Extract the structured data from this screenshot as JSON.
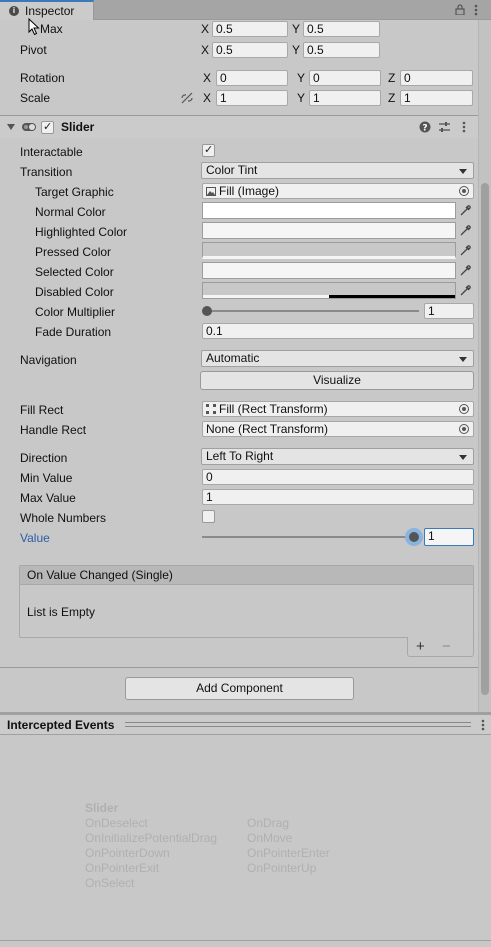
{
  "window": {
    "tab_label": "Inspector"
  },
  "rect_transform": {
    "max": {
      "label": "Max",
      "x": "0.5",
      "y": "0.5"
    },
    "pivot": {
      "label": "Pivot",
      "x": "0.5",
      "y": "0.5"
    },
    "rotation": {
      "label": "Rotation",
      "x": "0",
      "y": "0",
      "z": "0"
    },
    "scale": {
      "label": "Scale",
      "x": "1",
      "y": "1",
      "z": "1"
    }
  },
  "slider": {
    "title": "Slider",
    "interactable_label": "Interactable",
    "transition_label": "Transition",
    "transition_value": "Color Tint",
    "target_graphic_label": "Target Graphic",
    "target_graphic_value": "Fill (Image)",
    "normal_color_label": "Normal Color",
    "highlighted_color_label": "Highlighted Color",
    "pressed_color_label": "Pressed Color",
    "selected_color_label": "Selected Color",
    "disabled_color_label": "Disabled Color",
    "color_multiplier_label": "Color Multiplier",
    "color_multiplier_value": "1",
    "fade_duration_label": "Fade Duration",
    "fade_duration_value": "0.1",
    "navigation_label": "Navigation",
    "navigation_value": "Automatic",
    "visualize_label": "Visualize",
    "fill_rect_label": "Fill Rect",
    "fill_rect_value": "Fill (Rect Transform)",
    "handle_rect_label": "Handle Rect",
    "handle_rect_value": "None (Rect Transform)",
    "direction_label": "Direction",
    "direction_value": "Left To Right",
    "min_value_label": "Min Value",
    "min_value": "0",
    "max_value_label": "Max Value",
    "max_value": "1",
    "whole_numbers_label": "Whole Numbers",
    "value_label": "Value",
    "value": "1",
    "event_title": "On Value Changed (Single)",
    "event_empty": "List is Empty",
    "colors": {
      "normal": "#ffffff",
      "highlighted": "#f5f5f5",
      "pressed": "#c8c8c8",
      "selected": "#f5f5f5",
      "disabled": "#c8c8c8"
    }
  },
  "add_component_label": "Add Component",
  "intercepted": {
    "title": "Intercepted Events",
    "component": "Slider",
    "col1": [
      "OnDeselect",
      "OnInitializePotentialDrag",
      "OnPointerDown",
      "OnPointerExit",
      "OnSelect"
    ],
    "col2": [
      "OnDrag",
      "OnMove",
      "OnPointerEnter",
      "OnPointerUp"
    ]
  },
  "axis_labels": {
    "x": "X",
    "y": "Y",
    "z": "Z"
  }
}
